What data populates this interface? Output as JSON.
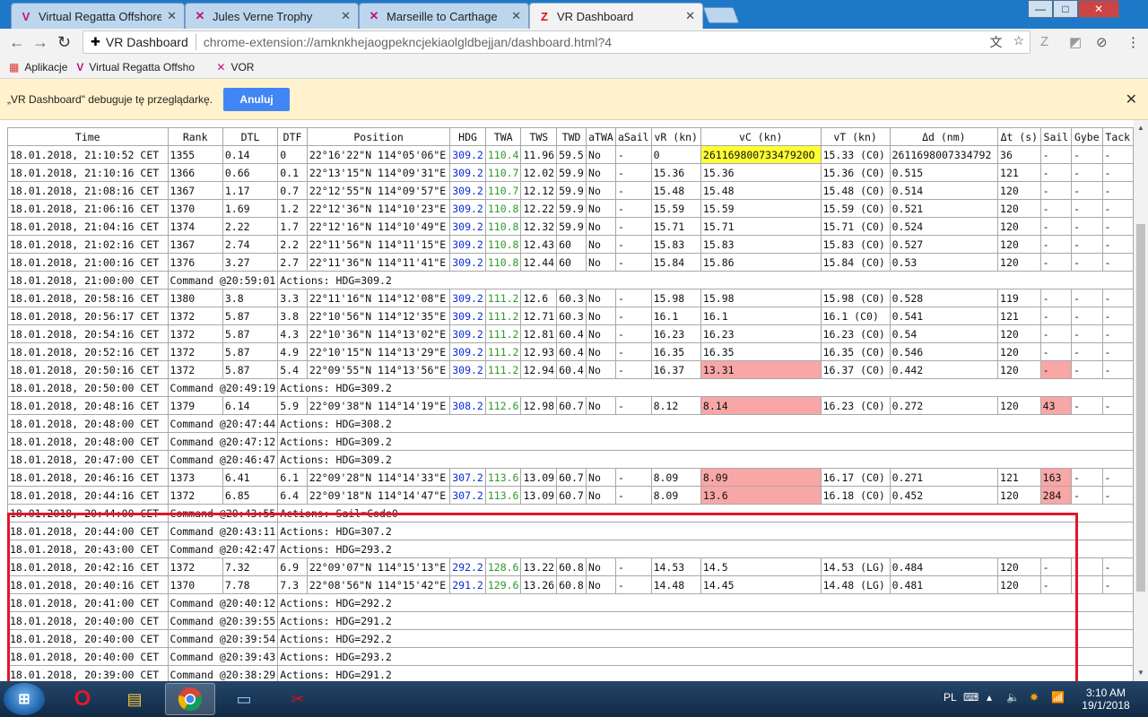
{
  "tabs": [
    {
      "title": "Virtual Regatta Offshore",
      "icon": "vr-logo-icon"
    },
    {
      "title": "Jules Verne Trophy",
      "icon": "vor-logo-icon"
    },
    {
      "title": "Marseille to Carthage",
      "icon": "vor-logo-icon"
    },
    {
      "title": "VR Dashboard",
      "icon": "z-logo-icon"
    }
  ],
  "window_controls": {
    "minimize": "—",
    "maximize": "□",
    "close": "✕"
  },
  "omnibox": {
    "site": "VR Dashboard",
    "url": "chrome-extension://amknkhejaogpekncjekiaolgldbejjan/dashboard.html?4"
  },
  "bookmarks": [
    {
      "label": "Aplikacje",
      "icon": "apps-icon"
    },
    {
      "label": "Virtual Regatta Offsho",
      "icon": "vr-logo-icon"
    },
    {
      "label": "VOR",
      "icon": "vor-logo-icon"
    }
  ],
  "infobar": {
    "message": "„VR Dashboard\" debuguje tę przeglądarkę.",
    "cancel_label": "Anuluj"
  },
  "table": {
    "headers": [
      "Time",
      "Rank",
      "DTL",
      "DTF",
      "Position",
      "HDG",
      "TWA",
      "TWS",
      "TWD",
      "aTWA",
      "aSail",
      "vR (kn)",
      "vC (kn)",
      "vT (kn)",
      "Δd (nm)",
      "Δt (s)",
      "Sail",
      "Gybe",
      "Tack"
    ],
    "rows": [
      {
        "t": "d",
        "time": "18.01.2018, 21:10:52 CET",
        "rank": "1355",
        "dtl": "0.14",
        "dtf": "0",
        "pos": "22°16'22\"N 114°05'06\"E",
        "hdg": "309.2",
        "twa": "110.4",
        "tws": "11.96",
        "twd": "59.5",
        "atwa": "No",
        "asail": "-",
        "vr": "0",
        "vc": "26116980073347920O",
        "vt": "15.33 (C0)",
        "dd": "26116980073347​92",
        "dt": "36",
        "sail": "-",
        "gybe": "-",
        "tack": "-",
        "vc_hl": "y"
      },
      {
        "t": "d",
        "time": "18.01.2018, 21:10:16 CET",
        "rank": "1366",
        "dtl": "0.66",
        "dtf": "0.1",
        "pos": "22°13'15\"N 114°09'31\"E",
        "hdg": "309.2",
        "twa": "110.7",
        "tws": "12.02",
        "twd": "59.9",
        "atwa": "No",
        "asail": "-",
        "vr": "15.36",
        "vc": "15.36",
        "vt": "15.36 (C0)",
        "dd": "0.515",
        "dt": "121",
        "sail": "-",
        "gybe": "-",
        "tack": "-"
      },
      {
        "t": "d",
        "time": "18.01.2018, 21:08:16 CET",
        "rank": "1367",
        "dtl": "1.17",
        "dtf": "0.7",
        "pos": "22°12'55\"N 114°09'57\"E",
        "hdg": "309.2",
        "twa": "110.7",
        "tws": "12.12",
        "twd": "59.9",
        "atwa": "No",
        "asail": "-",
        "vr": "15.48",
        "vc": "15.48",
        "vt": "15.48 (C0)",
        "dd": "0.514",
        "dt": "120",
        "sail": "-",
        "gybe": "-",
        "tack": "-"
      },
      {
        "t": "d",
        "time": "18.01.2018, 21:06:16 CET",
        "rank": "1370",
        "dtl": "1.69",
        "dtf": "1.2",
        "pos": "22°12'36\"N 114°10'23\"E",
        "hdg": "309.2",
        "twa": "110.8",
        "tws": "12.22",
        "twd": "59.9",
        "atwa": "No",
        "asail": "-",
        "vr": "15.59",
        "vc": "15.59",
        "vt": "15.59 (C0)",
        "dd": "0.521",
        "dt": "120",
        "sail": "-",
        "gybe": "-",
        "tack": "-"
      },
      {
        "t": "d",
        "time": "18.01.2018, 21:04:16 CET",
        "rank": "1374",
        "dtl": "2.22",
        "dtf": "1.7",
        "pos": "22°12'16\"N 114°10'49\"E",
        "hdg": "309.2",
        "twa": "110.8",
        "tws": "12.32",
        "twd": "59.9",
        "atwa": "No",
        "asail": "-",
        "vr": "15.71",
        "vc": "15.71",
        "vt": "15.71 (C0)",
        "dd": "0.524",
        "dt": "120",
        "sail": "-",
        "gybe": "-",
        "tack": "-"
      },
      {
        "t": "d",
        "time": "18.01.2018, 21:02:16 CET",
        "rank": "1367",
        "dtl": "2.74",
        "dtf": "2.2",
        "pos": "22°11'56\"N 114°11'15\"E",
        "hdg": "309.2",
        "twa": "110.8",
        "tws": "12.43",
        "twd": "60",
        "atwa": "No",
        "asail": "-",
        "vr": "15.83",
        "vc": "15.83",
        "vt": "15.83 (C0)",
        "dd": "0.527",
        "dt": "120",
        "sail": "-",
        "gybe": "-",
        "tack": "-"
      },
      {
        "t": "d",
        "time": "18.01.2018, 21:00:16 CET",
        "rank": "1376",
        "dtl": "3.27",
        "dtf": "2.7",
        "pos": "22°11'36\"N 114°11'41\"E",
        "hdg": "309.2",
        "twa": "110.8",
        "tws": "12.44",
        "twd": "60",
        "atwa": "No",
        "asail": "-",
        "vr": "15.84",
        "vc": "15.86",
        "vt": "15.84 (C0)",
        "dd": "0.53",
        "dt": "120",
        "sail": "-",
        "gybe": "-",
        "tack": "-"
      },
      {
        "t": "c",
        "time": "18.01.2018, 21:00:00 CET",
        "cmd": "Command @20:59:01",
        "action": "Actions: HDG=309.2"
      },
      {
        "t": "d",
        "time": "18.01.2018, 20:58:16 CET",
        "rank": "1380",
        "dtl": "3.8",
        "dtf": "3.3",
        "pos": "22°11'16\"N 114°12'08\"E",
        "hdg": "309.2",
        "twa": "111.2",
        "tws": "12.6",
        "twd": "60.3",
        "atwa": "No",
        "asail": "-",
        "vr": "15.98",
        "vc": "15.98",
        "vt": "15.98 (C0)",
        "dd": "0.528",
        "dt": "119",
        "sail": "-",
        "gybe": "-",
        "tack": "-"
      },
      {
        "t": "d",
        "time": "18.01.2018, 20:56:17 CET",
        "rank": "1372",
        "dtl": "5.87",
        "dtf": "3.8",
        "pos": "22°10'56\"N 114°12'35\"E",
        "hdg": "309.2",
        "twa": "111.2",
        "tws": "12.71",
        "twd": "60.3",
        "atwa": "No",
        "asail": "-",
        "vr": "16.1",
        "vc": "16.1",
        "vt": "16.1 (C0)",
        "dd": "0.541",
        "dt": "121",
        "sail": "-",
        "gybe": "-",
        "tack": "-"
      },
      {
        "t": "d",
        "time": "18.01.2018, 20:54:16 CET",
        "rank": "1372",
        "dtl": "5.87",
        "dtf": "4.3",
        "pos": "22°10'36\"N 114°13'02\"E",
        "hdg": "309.2",
        "twa": "111.2",
        "tws": "12.81",
        "twd": "60.4",
        "atwa": "No",
        "asail": "-",
        "vr": "16.23",
        "vc": "16.23",
        "vt": "16.23 (C0)",
        "dd": "0.54",
        "dt": "120",
        "sail": "-",
        "gybe": "-",
        "tack": "-"
      },
      {
        "t": "d",
        "time": "18.01.2018, 20:52:16 CET",
        "rank": "1372",
        "dtl": "5.87",
        "dtf": "4.9",
        "pos": "22°10'15\"N 114°13'29\"E",
        "hdg": "309.2",
        "twa": "111.2",
        "tws": "12.93",
        "twd": "60.4",
        "atwa": "No",
        "asail": "-",
        "vr": "16.35",
        "vc": "16.35",
        "vt": "16.35 (C0)",
        "dd": "0.546",
        "dt": "120",
        "sail": "-",
        "gybe": "-",
        "tack": "-"
      },
      {
        "t": "d",
        "time": "18.01.2018, 20:50:16 CET",
        "rank": "1372",
        "dtl": "5.87",
        "dtf": "5.4",
        "pos": "22°09'55\"N 114°13'56\"E",
        "hdg": "309.2",
        "twa": "111.2",
        "tws": "12.94",
        "twd": "60.4",
        "atwa": "No",
        "asail": "-",
        "vr": "16.37",
        "vc": "13.31",
        "vt": "16.37 (C0)",
        "dd": "0.442",
        "dt": "120",
        "sail": "-",
        "gybe": "-",
        "tack": "-",
        "vc_hl": "r",
        "sail_hl": "r"
      },
      {
        "t": "c",
        "time": "18.01.2018, 20:50:00 CET",
        "cmd": "Command @20:49:19",
        "action": "Actions: HDG=309.2"
      },
      {
        "t": "d",
        "time": "18.01.2018, 20:48:16 CET",
        "rank": "1379",
        "dtl": "6.14",
        "dtf": "5.9",
        "pos": "22°09'38\"N 114°14'19\"E",
        "hdg": "308.2",
        "twa": "112.6",
        "tws": "12.98",
        "twd": "60.7",
        "atwa": "No",
        "asail": "-",
        "vr": "8.12",
        "vc": "8.14",
        "vt": "16.23 (C0)",
        "dd": "0.272",
        "dt": "120",
        "sail": "43",
        "gybe": "-",
        "tack": "-",
        "vc_hl": "r",
        "sail_hl": "r"
      },
      {
        "t": "c",
        "time": "18.01.2018, 20:48:00 CET",
        "cmd": "Command @20:47:44",
        "action": "Actions: HDG=308.2"
      },
      {
        "t": "c",
        "time": "18.01.2018, 20:48:00 CET",
        "cmd": "Command @20:47:12",
        "action": "Actions: HDG=309.2"
      },
      {
        "t": "c",
        "time": "18.01.2018, 20:47:00 CET",
        "cmd": "Command @20:46:47",
        "action": "Actions: HDG=309.2"
      },
      {
        "t": "d",
        "time": "18.01.2018, 20:46:16 CET",
        "rank": "1373",
        "dtl": "6.41",
        "dtf": "6.1",
        "pos": "22°09'28\"N 114°14'33\"E",
        "hdg": "307.2",
        "twa": "113.6",
        "tws": "13.09",
        "twd": "60.7",
        "atwa": "No",
        "asail": "-",
        "vr": "8.09",
        "vc": "8.09",
        "vt": "16.17 (C0)",
        "dd": "0.271",
        "dt": "121",
        "sail": "163",
        "gybe": "-",
        "tack": "-",
        "vc_hl": "r",
        "sail_hl": "r"
      },
      {
        "t": "d",
        "time": "18.01.2018, 20:44:16 CET",
        "rank": "1372",
        "dtl": "6.85",
        "dtf": "6.4",
        "pos": "22°09'18\"N 114°14'47\"E",
        "hdg": "307.2",
        "twa": "113.6",
        "tws": "13.09",
        "twd": "60.7",
        "atwa": "No",
        "asail": "-",
        "vr": "8.09",
        "vc": "13.6",
        "vt": "16.18 (C0)",
        "dd": "0.452",
        "dt": "120",
        "sail": "284",
        "gybe": "-",
        "tack": "-",
        "vc_hl": "r",
        "sail_hl": "r"
      },
      {
        "t": "c",
        "time": "18.01.2018, 20:44:00 CET",
        "cmd": "Command @20:43:55",
        "action": "Actions: Sail=Code0"
      },
      {
        "t": "c",
        "time": "18.01.2018, 20:44:00 CET",
        "cmd": "Command @20:43:11",
        "action": "Actions: HDG=307.2"
      },
      {
        "t": "c",
        "time": "18.01.2018, 20:43:00 CET",
        "cmd": "Command @20:42:47",
        "action": "Actions: HDG=293.2"
      },
      {
        "t": "d",
        "time": "18.01.2018, 20:42:16 CET",
        "rank": "1372",
        "dtl": "7.32",
        "dtf": "6.9",
        "pos": "22°09'07\"N 114°15'13\"E",
        "hdg": "292.2",
        "twa": "128.6",
        "tws": "13.22",
        "twd": "60.8",
        "atwa": "No",
        "asail": "-",
        "vr": "14.53",
        "vc": "14.5",
        "vt": "14.53 (LG)",
        "dd": "0.484",
        "dt": "120",
        "sail": "-",
        "gybe": "-",
        "tack": "-"
      },
      {
        "t": "d",
        "time": "18.01.2018, 20:40:16 CET",
        "rank": "1370",
        "dtl": "7.78",
        "dtf": "7.3",
        "pos": "22°08'56\"N 114°15'42\"E",
        "hdg": "291.2",
        "twa": "129.6",
        "tws": "13.26",
        "twd": "60.8",
        "atwa": "No",
        "asail": "-",
        "vr": "14.48",
        "vc": "14.45",
        "vt": "14.48 (LG)",
        "dd": "0.481",
        "dt": "120",
        "sail": "-",
        "gybe": "-",
        "tack": "-"
      },
      {
        "t": "c",
        "time": "18.01.2018, 20:41:00 CET",
        "cmd": "Command @20:40:12",
        "action": "Actions: HDG=292.2"
      },
      {
        "t": "c",
        "time": "18.01.2018, 20:40:00 CET",
        "cmd": "Command @20:39:55",
        "action": "Actions: HDG=291.2"
      },
      {
        "t": "c",
        "time": "18.01.2018, 20:40:00 CET",
        "cmd": "Command @20:39:54",
        "action": "Actions: HDG=292.2"
      },
      {
        "t": "c",
        "time": "18.01.2018, 20:40:00 CET",
        "cmd": "Command @20:39:43",
        "action": "Actions: HDG=293.2"
      },
      {
        "t": "c",
        "time": "18.01.2018, 20:39:00 CET",
        "cmd": "Command @20:38:29",
        "action": "Actions: HDG=291.2"
      }
    ]
  },
  "taskbar": {
    "apps": [
      {
        "name": "opera-icon"
      },
      {
        "name": "file-explorer-icon"
      },
      {
        "name": "chrome-icon"
      },
      {
        "name": "remote-desktop-icon"
      },
      {
        "name": "snipping-tool-icon"
      }
    ],
    "language": "PL",
    "time": "3:10 AM",
    "date": "19/1/2018"
  },
  "colors": {
    "hdg": "#0b2bd6",
    "twa": "#2a9a2a",
    "highlight_yellow": "#ffff33",
    "highlight_red": "#f9a6a6",
    "annotation_box": "#e0162b"
  }
}
